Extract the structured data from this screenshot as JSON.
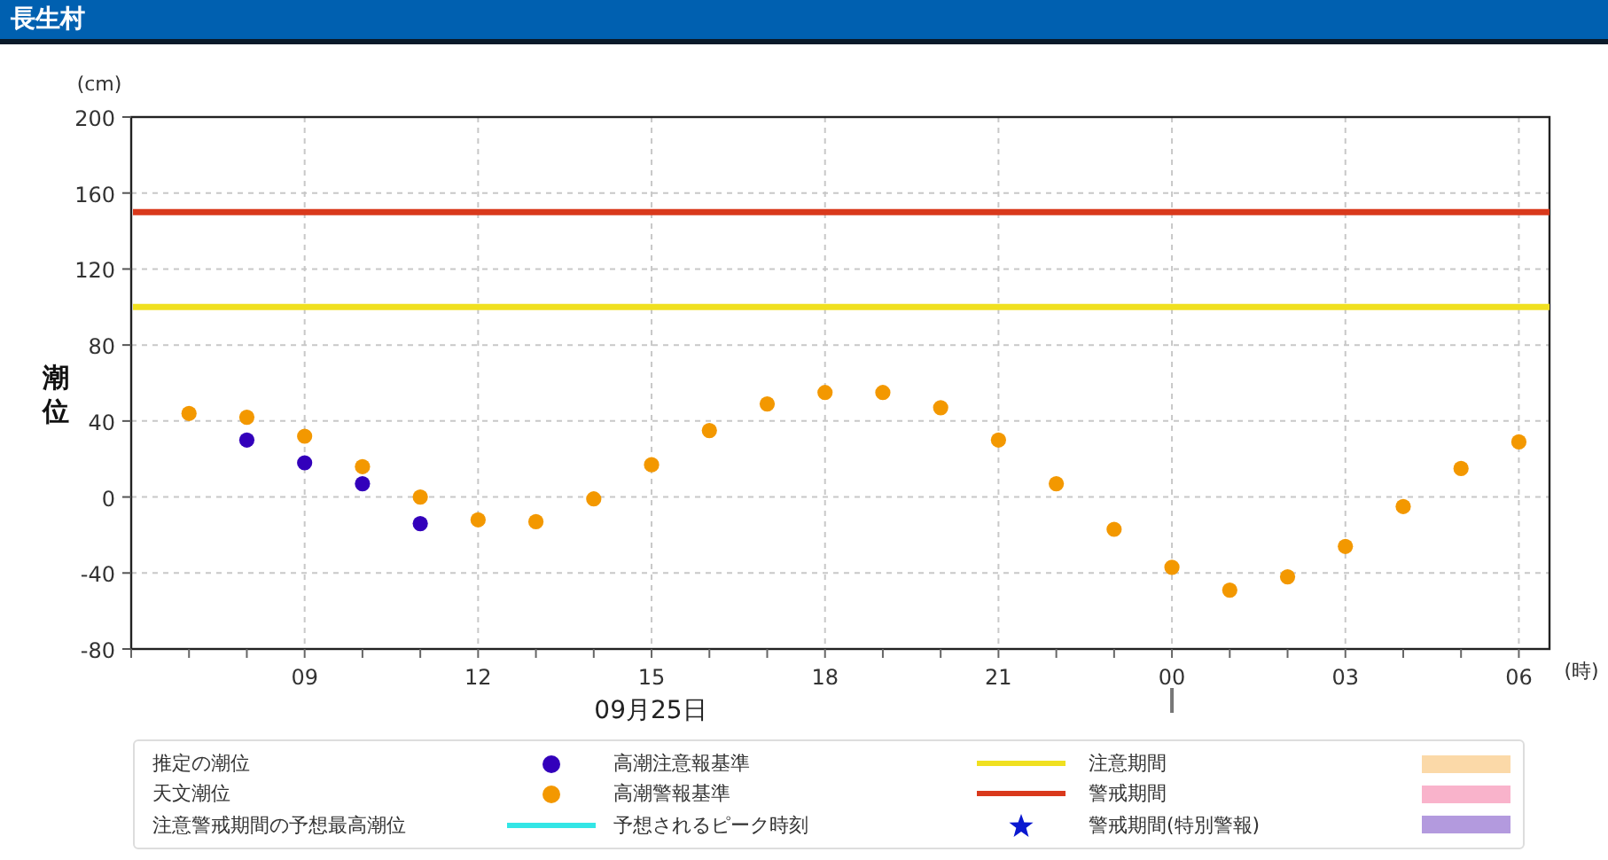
{
  "title": "長生村",
  "axis_texts": {
    "y_unit": "(cm)",
    "x_unit": "(時)",
    "date": "09月25日"
  },
  "chart_data": {
    "type": "scatter",
    "ylabel": "潮位",
    "categories": [
      null,
      null,
      "09",
      null,
      null,
      "12",
      null,
      null,
      "15",
      null,
      null,
      "18",
      null,
      null,
      "21",
      null,
      null,
      "00",
      null,
      null,
      "03",
      null,
      null,
      "06"
    ],
    "ylim": [
      -80,
      200
    ],
    "yticks": [
      -80,
      -40,
      0,
      40,
      80,
      120,
      160,
      200
    ],
    "series": [
      {
        "name": "天文潮位",
        "color": "#f39800",
        "values": [
          44,
          42,
          32,
          16,
          0,
          -12,
          -13,
          -1,
          17,
          35,
          49,
          55,
          55,
          47,
          30,
          7,
          -17,
          -37,
          -49,
          -42,
          -26,
          -5,
          15,
          29
        ]
      },
      {
        "name": "推定の潮位",
        "color": "#3300bb",
        "values": [
          null,
          30,
          18,
          7,
          -14,
          null,
          null,
          null,
          null,
          null,
          null,
          null,
          null,
          null,
          null,
          null,
          null,
          null,
          null,
          null,
          null,
          null,
          null,
          null
        ]
      }
    ],
    "ref_lines": [
      {
        "axis": "y",
        "value": 100,
        "label": "高潮注意報基準",
        "color": "#f0e020"
      },
      {
        "axis": "y",
        "value": 150,
        "label": "高潮警報基準",
        "color": "#d9391c"
      }
    ],
    "grid": true
  },
  "legend": [
    {
      "label": "注意期間",
      "kind": "band",
      "color": "#fbd9a8"
    },
    {
      "label": "警戒期間",
      "kind": "band",
      "color": "#f9b3cb"
    },
    {
      "label": "注意警戒期間の予想最高潮位",
      "kind": "line",
      "color": "#33e6e6"
    },
    {
      "label": "予想されるピーク時刻",
      "kind": "star",
      "color": "#0a18d0"
    },
    {
      "label": "警戒期間(特別警報)",
      "kind": "band",
      "color": "#b39ade"
    }
  ]
}
